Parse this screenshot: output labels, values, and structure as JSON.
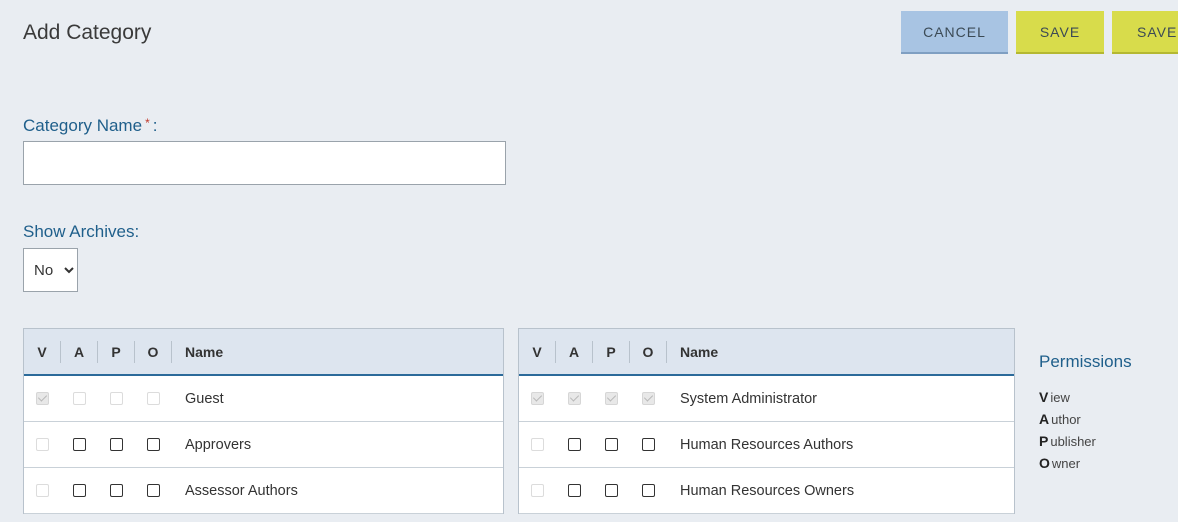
{
  "header": {
    "title": "Add Category",
    "cancel_label": "CANCEL",
    "save_label": "SAVE",
    "save2_label": "SAVE"
  },
  "form": {
    "category_name_label": "Category Name",
    "required_mark": "*",
    "colon": ":",
    "category_name_value": "",
    "show_archives_label": "Show Archives:",
    "show_archives_value": "No"
  },
  "table": {
    "headers": [
      "V",
      "A",
      "P",
      "O",
      "Name"
    ]
  },
  "left_rows": [
    {
      "name": "Guest",
      "v": "checked-disabled",
      "a": "disabled",
      "p": "disabled",
      "o": "disabled"
    },
    {
      "name": "Approvers",
      "v": "disabled",
      "a": "unchecked",
      "p": "unchecked",
      "o": "unchecked"
    },
    {
      "name": "Assessor Authors",
      "v": "disabled",
      "a": "unchecked",
      "p": "unchecked",
      "o": "unchecked"
    }
  ],
  "right_rows": [
    {
      "name": "System Administrator",
      "v": "checked-disabled",
      "a": "checked-disabled",
      "p": "checked-disabled",
      "o": "checked-disabled"
    },
    {
      "name": "Human Resources Authors",
      "v": "disabled",
      "a": "unchecked",
      "p": "unchecked",
      "o": "unchecked"
    },
    {
      "name": "Human Resources Owners",
      "v": "disabled",
      "a": "unchecked",
      "p": "unchecked",
      "o": "unchecked"
    }
  ],
  "legend": {
    "title": "Permissions",
    "items": [
      {
        "letter": "V",
        "rest": "iew"
      },
      {
        "letter": "A",
        "rest": "uthor"
      },
      {
        "letter": "P",
        "rest": "ublisher"
      },
      {
        "letter": "O",
        "rest": "wner"
      }
    ]
  }
}
